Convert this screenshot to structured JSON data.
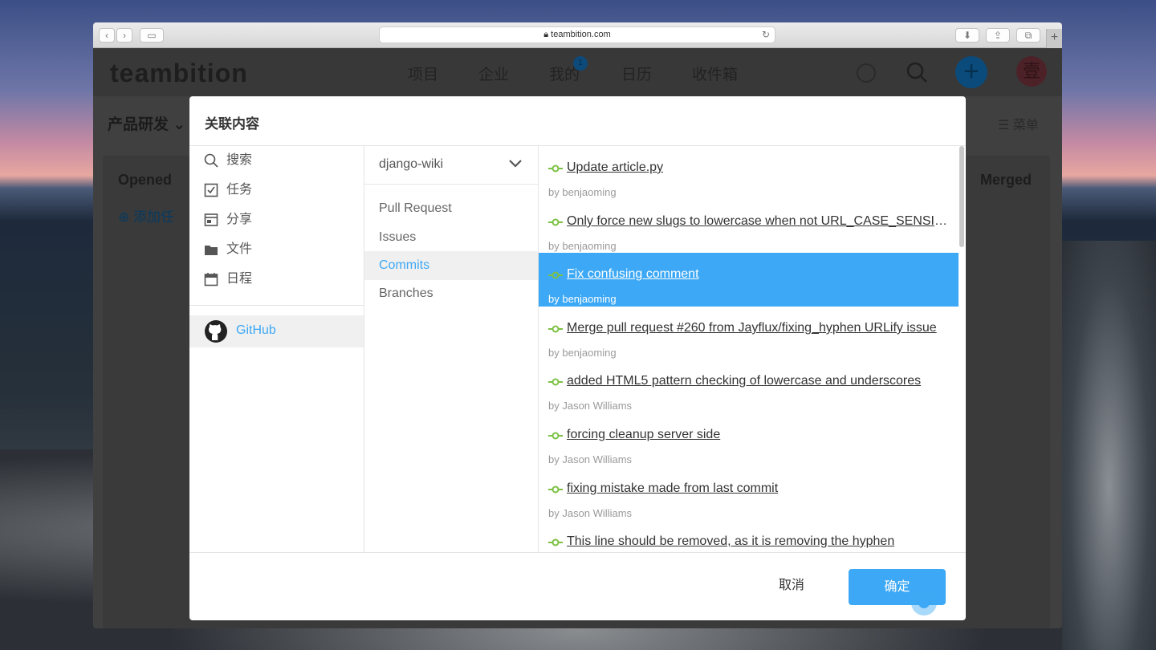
{
  "browser": {
    "url": "teambition.com"
  },
  "app": {
    "logo": "teambition",
    "nav": [
      "项目",
      "企业",
      "我的",
      "日历",
      "收件箱"
    ],
    "nav_badge": "1",
    "avatar_text": "壹",
    "project_name": "产品研发",
    "menu_label": "菜单",
    "columns": {
      "opened": "Opened",
      "merged": "Merged"
    },
    "add_task": "添加任"
  },
  "dialog": {
    "title": "关联内容",
    "left_items": [
      {
        "label": "搜索",
        "icon": "search-icon"
      },
      {
        "label": "任务",
        "icon": "checkbox-icon"
      },
      {
        "label": "分享",
        "icon": "share-icon"
      },
      {
        "label": "文件",
        "icon": "folder-icon"
      },
      {
        "label": "日程",
        "icon": "calendar-icon"
      }
    ],
    "github_label": "GitHub",
    "repo": "django-wiki",
    "mid_items": [
      "Pull Request",
      "Issues",
      "Commits",
      "Branches"
    ],
    "mid_active": "Commits",
    "commits": [
      {
        "title": "Update article.py",
        "author": "by benjaoming"
      },
      {
        "title": "Only force new slugs to lowercase when not URL_CASE_SENSITIVE",
        "author": "by benjaoming"
      },
      {
        "title": "Fix confusing comment",
        "author": "by benjaoming",
        "selected": true
      },
      {
        "title": "Merge pull request #260 from Jayflux/fixing_hyphen URLify issue",
        "author": "by benjaoming"
      },
      {
        "title": "added HTML5 pattern checking of lowercase and underscores",
        "author": "by Jason Williams"
      },
      {
        "title": "forcing cleanup server side",
        "author": "by Jason Williams"
      },
      {
        "title": "fixing mistake made from last commit",
        "author": "by Jason Williams"
      },
      {
        "title": "This line should be removed, as it is removing the hyphen",
        "author": ""
      }
    ],
    "cancel": "取消",
    "ok": "确定"
  },
  "colors": {
    "accent": "#3da8f5",
    "commit_icon": "#7cc144"
  }
}
